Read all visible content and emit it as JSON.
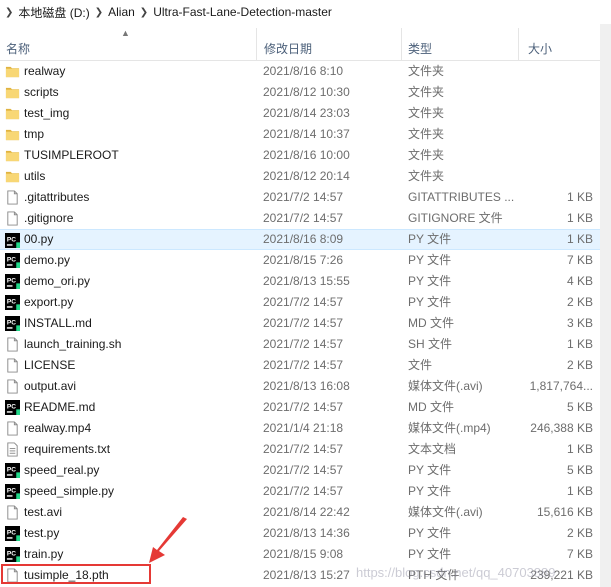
{
  "breadcrumb": {
    "segments": [
      "本地磁盘 (D:)",
      "Alian",
      "Ultra-Fast-Lane-Detection-master"
    ]
  },
  "columns": {
    "name": "名称",
    "date": "修改日期",
    "type": "类型",
    "size": "大小"
  },
  "rows": [
    {
      "name": "realway",
      "date": "2021/8/16 8:10",
      "type": "文件夹",
      "size": "",
      "icon": "folder"
    },
    {
      "name": "scripts",
      "date": "2021/8/12 10:30",
      "type": "文件夹",
      "size": "",
      "icon": "folder"
    },
    {
      "name": "test_img",
      "date": "2021/8/14 23:03",
      "type": "文件夹",
      "size": "",
      "icon": "folder"
    },
    {
      "name": "tmp",
      "date": "2021/8/14 10:37",
      "type": "文件夹",
      "size": "",
      "icon": "folder"
    },
    {
      "name": "TUSIMPLEROOT",
      "date": "2021/8/16 10:00",
      "type": "文件夹",
      "size": "",
      "icon": "folder"
    },
    {
      "name": "utils",
      "date": "2021/8/12 20:14",
      "type": "文件夹",
      "size": "",
      "icon": "folder"
    },
    {
      "name": ".gitattributes",
      "date": "2021/7/2 14:57",
      "type": "GITATTRIBUTES ...",
      "size": "1 KB",
      "icon": "file"
    },
    {
      "name": ".gitignore",
      "date": "2021/7/2 14:57",
      "type": "GITIGNORE 文件",
      "size": "1 KB",
      "icon": "file"
    },
    {
      "name": "00.py",
      "date": "2021/8/16 8:09",
      "type": "PY 文件",
      "size": "1 KB",
      "icon": "pycharm",
      "selected": true
    },
    {
      "name": "demo.py",
      "date": "2021/8/15 7:26",
      "type": "PY 文件",
      "size": "7 KB",
      "icon": "pycharm"
    },
    {
      "name": "demo_ori.py",
      "date": "2021/8/13 15:55",
      "type": "PY 文件",
      "size": "4 KB",
      "icon": "pycharm"
    },
    {
      "name": "export.py",
      "date": "2021/7/2 14:57",
      "type": "PY 文件",
      "size": "2 KB",
      "icon": "pycharm"
    },
    {
      "name": "INSTALL.md",
      "date": "2021/7/2 14:57",
      "type": "MD 文件",
      "size": "3 KB",
      "icon": "pycharm"
    },
    {
      "name": "launch_training.sh",
      "date": "2021/7/2 14:57",
      "type": "SH 文件",
      "size": "1 KB",
      "icon": "file"
    },
    {
      "name": "LICENSE",
      "date": "2021/7/2 14:57",
      "type": "文件",
      "size": "2 KB",
      "icon": "file"
    },
    {
      "name": "output.avi",
      "date": "2021/8/13 16:08",
      "type": "媒体文件(.avi)",
      "size": "1,817,764...",
      "icon": "file"
    },
    {
      "name": "README.md",
      "date": "2021/7/2 14:57",
      "type": "MD 文件",
      "size": "5 KB",
      "icon": "pycharm"
    },
    {
      "name": "realway.mp4",
      "date": "2021/1/4 21:18",
      "type": "媒体文件(.mp4)",
      "size": "246,388 KB",
      "icon": "file"
    },
    {
      "name": "requirements.txt",
      "date": "2021/7/2 14:57",
      "type": "文本文档",
      "size": "1 KB",
      "icon": "text"
    },
    {
      "name": "speed_real.py",
      "date": "2021/7/2 14:57",
      "type": "PY 文件",
      "size": "5 KB",
      "icon": "pycharm"
    },
    {
      "name": "speed_simple.py",
      "date": "2021/7/2 14:57",
      "type": "PY 文件",
      "size": "1 KB",
      "icon": "pycharm"
    },
    {
      "name": "test.avi",
      "date": "2021/8/14 22:42",
      "type": "媒体文件(.avi)",
      "size": "15,616 KB",
      "icon": "file"
    },
    {
      "name": "test.py",
      "date": "2021/8/13 14:36",
      "type": "PY 文件",
      "size": "2 KB",
      "icon": "pycharm"
    },
    {
      "name": "train.py",
      "date": "2021/8/15 9:08",
      "type": "PY 文件",
      "size": "7 KB",
      "icon": "pycharm"
    },
    {
      "name": "tusimple_18.pth",
      "date": "2021/8/13 15:27",
      "type": "PTH 文件",
      "size": "239,221 KB",
      "icon": "file"
    }
  ],
  "watermark": "https://blog.csdn.net/qq_40703889",
  "colors": {
    "folder": "#f8d775",
    "folder_dark": "#e0b340",
    "pycharm_bg": "#000000",
    "selected_bg": "#e5f3ff",
    "annotation_red": "#e53935"
  }
}
